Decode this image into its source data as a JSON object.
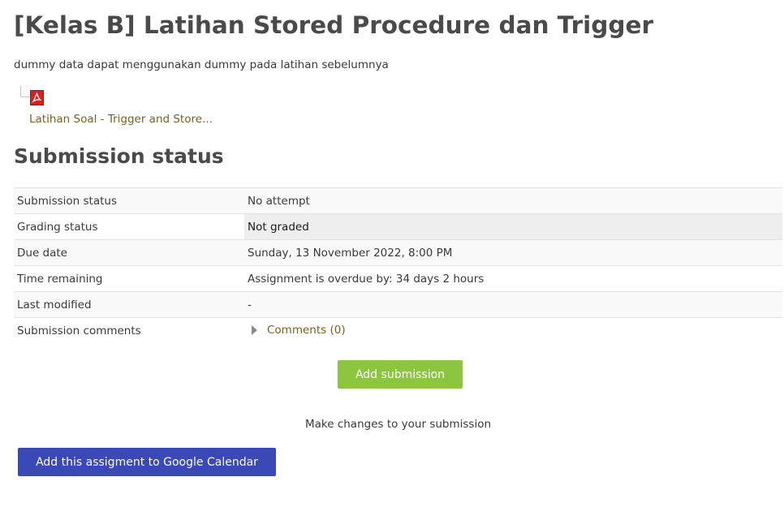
{
  "assignment": {
    "title": "[Kelas B] Latihan Stored Procedure dan Trigger",
    "intro": "dummy data dapat menggunakan dummy pada latihan sebelumnya",
    "attachment": {
      "icon": "pdf-icon",
      "name": "Latihan Soal - Trigger and Store..."
    }
  },
  "submission_status": {
    "heading": "Submission status",
    "rows": [
      {
        "label": "Submission status",
        "value": "No attempt"
      },
      {
        "label": "Grading status",
        "value": "Not graded"
      },
      {
        "label": "Due date",
        "value": "Sunday, 13 November 2022, 8:00 PM"
      },
      {
        "label": "Time remaining",
        "value": "Assignment is overdue by: 34 days 2 hours"
      },
      {
        "label": "Last modified",
        "value": "-"
      },
      {
        "label": "Submission comments",
        "value": "Comments (0)"
      }
    ]
  },
  "actions": {
    "add_submission_label": "Add submission",
    "help_text": "Make changes to your submission",
    "google_calendar_label": "Add this assigment to Google Calendar"
  },
  "colors": {
    "link": "#7b6021",
    "add_submission_bg": "#8cc63f",
    "google_calendar_bg": "#3a49b5"
  }
}
